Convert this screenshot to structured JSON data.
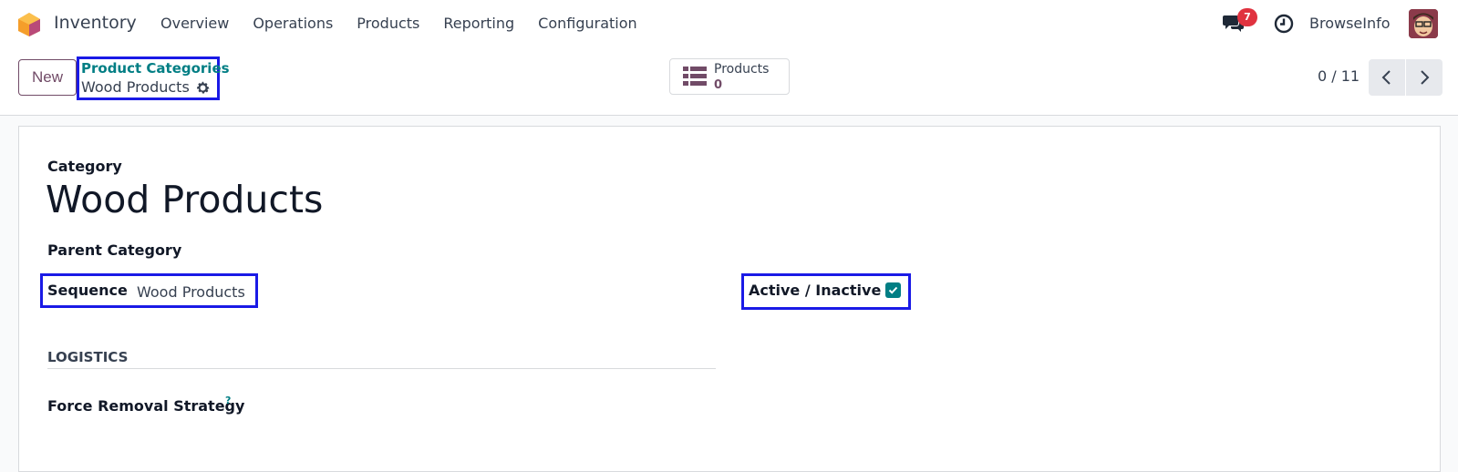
{
  "navbar": {
    "app_name": "Inventory",
    "menu": [
      "Overview",
      "Operations",
      "Products",
      "Reporting",
      "Configuration"
    ],
    "messages_badge": "7",
    "company": "BrowseInfo",
    "icons": [
      "app-logo-icon",
      "chat-icon",
      "clock-icon",
      "avatar"
    ]
  },
  "control": {
    "new_label": "New",
    "breadcrumb_parent": "Product Categories",
    "breadcrumb_current": "Wood Products",
    "smart_button": {
      "label": "Products",
      "value": "0"
    },
    "pager": "0 / 11"
  },
  "form": {
    "category_label": "Category",
    "name": "Wood Products",
    "parent_category_label": "Parent Category",
    "sequence_label": "Sequence",
    "sequence_value": "Wood Products",
    "active_label": "Active / Inactive",
    "active_checked": true,
    "logistics_heading": "LOGISTICS",
    "removal_label": "Force Removal Strategy",
    "help_marker": "?"
  },
  "colors": {
    "brand": "#714b67",
    "teal": "#017e84",
    "badge": "#e0323f",
    "highlight": "#1a1ae6"
  }
}
